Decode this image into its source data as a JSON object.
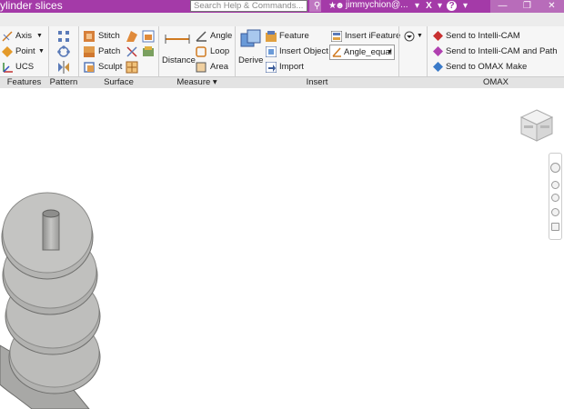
{
  "app": {
    "title": "ylinder slices"
  },
  "search": {
    "placeholder": "Search Help & Commands..."
  },
  "user": {
    "name": "jimmychion@..."
  },
  "ribbon": {
    "groups": [
      {
        "label": "Features"
      },
      {
        "label": "Pattern"
      },
      {
        "label": "Surface"
      },
      {
        "label": "Measure ▾"
      },
      {
        "label": "Insert"
      },
      {
        "label": "OMAX"
      }
    ],
    "features": {
      "axis": "Axis",
      "point": "Point",
      "ucs": "UCS"
    },
    "surface": {
      "stitch": "Stitch",
      "patch": "Patch",
      "sculpt": "Sculpt"
    },
    "measure": {
      "distance": "Distance",
      "angle": "Angle",
      "loop": "Loop",
      "area": "Area"
    },
    "insert": {
      "derive": "Derive",
      "feature": "Feature",
      "insert_object": "Insert Object",
      "import": "Import",
      "insert_ifeature": "Insert iFeature",
      "angle_equal": "Angle_equal"
    },
    "omax": {
      "send_intellicam": "Send to Intelli-CAM",
      "send_intellicam_path": "Send to Intelli-CAM and Path",
      "send_omax_make": "Send to OMAX Make"
    }
  },
  "colors": {
    "titlebar": "#a43aa8",
    "model": "#b8b8b6",
    "model_edge": "#6e6e6c"
  }
}
